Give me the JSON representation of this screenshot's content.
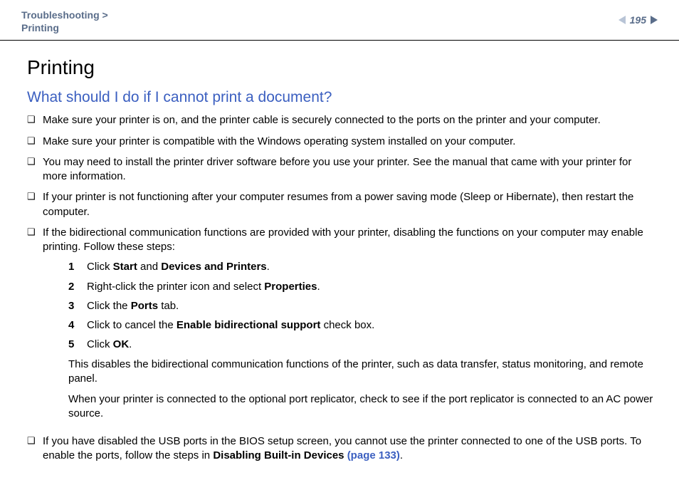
{
  "header": {
    "breadcrumb_line1": "Troubleshooting >",
    "breadcrumb_line2": "Printing",
    "page_number": "195"
  },
  "title": "Printing",
  "question": "What should I do if I cannot print a document?",
  "bullets": [
    "Make sure your printer is on, and the printer cable is securely connected to the ports on the printer and your computer.",
    "Make sure your printer is compatible with the Windows operating system installed on your computer.",
    "You may need to install the printer driver software before you use your printer. See the manual that came with your printer for more information.",
    "If your printer is not functioning after your computer resumes from a power saving mode (Sleep or Hibernate), then restart the computer.",
    "If the bidirectional communication functions are provided with your printer, disabling the functions on your computer may enable printing. Follow these steps:"
  ],
  "steps": {
    "s1a": "Click ",
    "s1b": "Start",
    "s1c": " and ",
    "s1d": "Devices and Printers",
    "s1e": ".",
    "s2a": "Right-click the printer icon and select ",
    "s2b": "Properties",
    "s2c": ".",
    "s3a": "Click the ",
    "s3b": "Ports",
    "s3c": " tab.",
    "s4a": "Click to cancel the ",
    "s4b": "Enable bidirectional support",
    "s4c": " check box.",
    "s5a": "Click ",
    "s5b": "OK",
    "s5c": "."
  },
  "after1": "This disables the bidirectional communication functions of the printer, such as data transfer, status monitoring, and remote panel.",
  "after2": "When your printer is connected to the optional port replicator, check to see if the port replicator is connected to an AC power source.",
  "last": {
    "a": "If you have disabled the USB ports in the BIOS setup screen, you cannot use the printer connected to one of the USB ports. To enable the ports, follow the steps in ",
    "b": "Disabling Built-in Devices ",
    "link": "(page 133)",
    "c": "."
  }
}
